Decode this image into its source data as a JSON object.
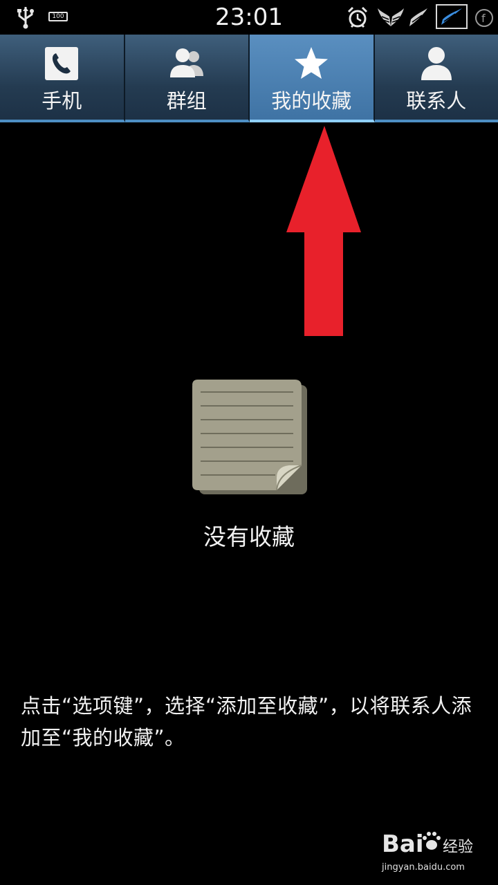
{
  "status_bar": {
    "time": "23:01",
    "battery_label": "100",
    "icons": [
      "usb-icon",
      "battery-icon",
      "alarm-icon",
      "wing-icon",
      "wing-icon",
      "wing-box-icon",
      "facebook-icon"
    ]
  },
  "tabs": [
    {
      "label": "手机",
      "icon": "phone-icon",
      "active": false
    },
    {
      "label": "群组",
      "icon": "group-icon",
      "active": false
    },
    {
      "label": "我的收藏",
      "icon": "star-icon",
      "active": true
    },
    {
      "label": "联系人",
      "icon": "person-icon",
      "active": false
    }
  ],
  "annotation": {
    "arrow_color": "#e8212b",
    "icon": "red-up-arrow"
  },
  "empty_state": {
    "icon": "empty-notes-icon",
    "title": "没有收藏",
    "hint": "点击“选项键”，选择“添加至收藏”，以将联系人添加至“我的收藏”。"
  },
  "watermark": {
    "brand": "Bai",
    "brand_suffix": "经验",
    "url": "jingyan.baidu.com"
  },
  "colors": {
    "tab_active": "#4f86b8",
    "tab_bg": "#2b4560",
    "tab_underline": "#8fd0ff",
    "background": "#000000"
  }
}
